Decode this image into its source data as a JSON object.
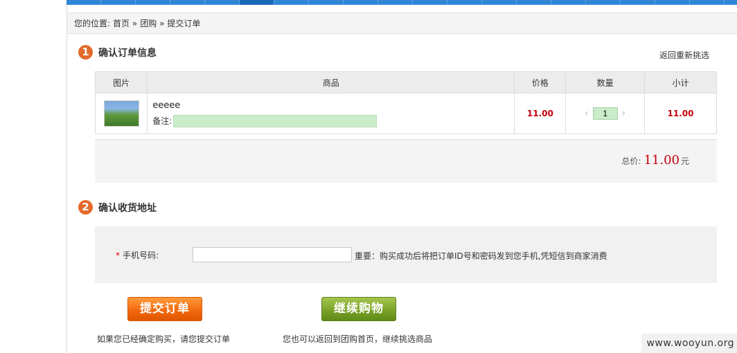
{
  "breadcrumb": {
    "prefix": "您的位置:",
    "home": "首页",
    "sep1": "»",
    "groupbuy": "团购",
    "sep2": "»",
    "current": "提交订单"
  },
  "section1": {
    "step": "1",
    "title": "确认订单信息",
    "reselect_link": "返回重新挑选"
  },
  "order_table": {
    "headers": [
      "图片",
      "商品",
      "价格",
      "数量",
      "小计"
    ],
    "row": {
      "image_icon": "landscape-photo-thumbnail",
      "name": "eeeee",
      "remark_label": "备注:",
      "remark_value": "",
      "price": "11.00",
      "qty_decrease": "‹",
      "quantity": "1",
      "qty_increase": "›",
      "subtotal": "11.00"
    }
  },
  "total": {
    "label": "总价:",
    "amount": "11.00",
    "unit": "元"
  },
  "section2": {
    "step": "2",
    "title": "确认收货地址"
  },
  "address": {
    "required_mark": "*",
    "phone_label": "手机号码:",
    "phone_value": "",
    "phone_note": "重要：购买成功后将把订单ID号和密码发到您手机,凭短信到商家消费"
  },
  "buttons": {
    "submit": "提交订单",
    "continue": "继续购物"
  },
  "hints": {
    "submit_hint": "如果您已经确定购买，请您提交订单",
    "continue_hint": "您也可以返回到团购首页，继续挑选商品"
  },
  "watermark": "www.wooyun.org",
  "colors": {
    "accent_blue": "#2f86d6",
    "step_orange": "#e4692b",
    "price_red": "#c4000b",
    "submit_orange": "#f36b0f",
    "continue_green": "#7ba32a",
    "input_green": "#c9ecc9"
  }
}
